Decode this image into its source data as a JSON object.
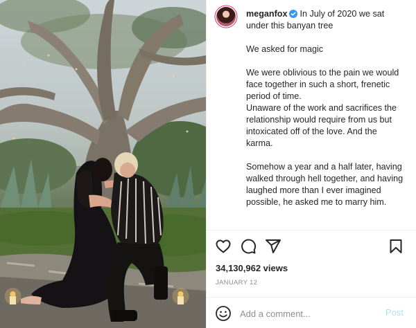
{
  "post": {
    "username": "meganfox",
    "verified": true,
    "caption": {
      "first": "In July of 2020 we sat under this banyan tree",
      "paragraphs": [
        "We asked for magic",
        "We were oblivious to the pain we would face together in such a short, frenetic period of time.",
        "Unaware of the work and sacrifices the relationship would require from us but intoxicated off of the love. And the karma.",
        "Somehow a year and a half later, having walked through hell together, and having laughed more than I ever imagined possible, he asked me to marry him."
      ]
    },
    "views": "34,130,962 views",
    "date": "JANUARY 12"
  },
  "actions": {
    "like_icon": "heart-icon",
    "comment_icon": "comment-bubble-icon",
    "share_icon": "paper-plane-icon",
    "save_icon": "bookmark-icon"
  },
  "comment": {
    "placeholder": "Add a comment...",
    "post_label": "Post",
    "emoji_icon": "smiley-icon"
  },
  "colors": {
    "verified": "#3897f0",
    "post_disabled": "#b2dffc",
    "secondary_text": "#8e8e8e"
  }
}
